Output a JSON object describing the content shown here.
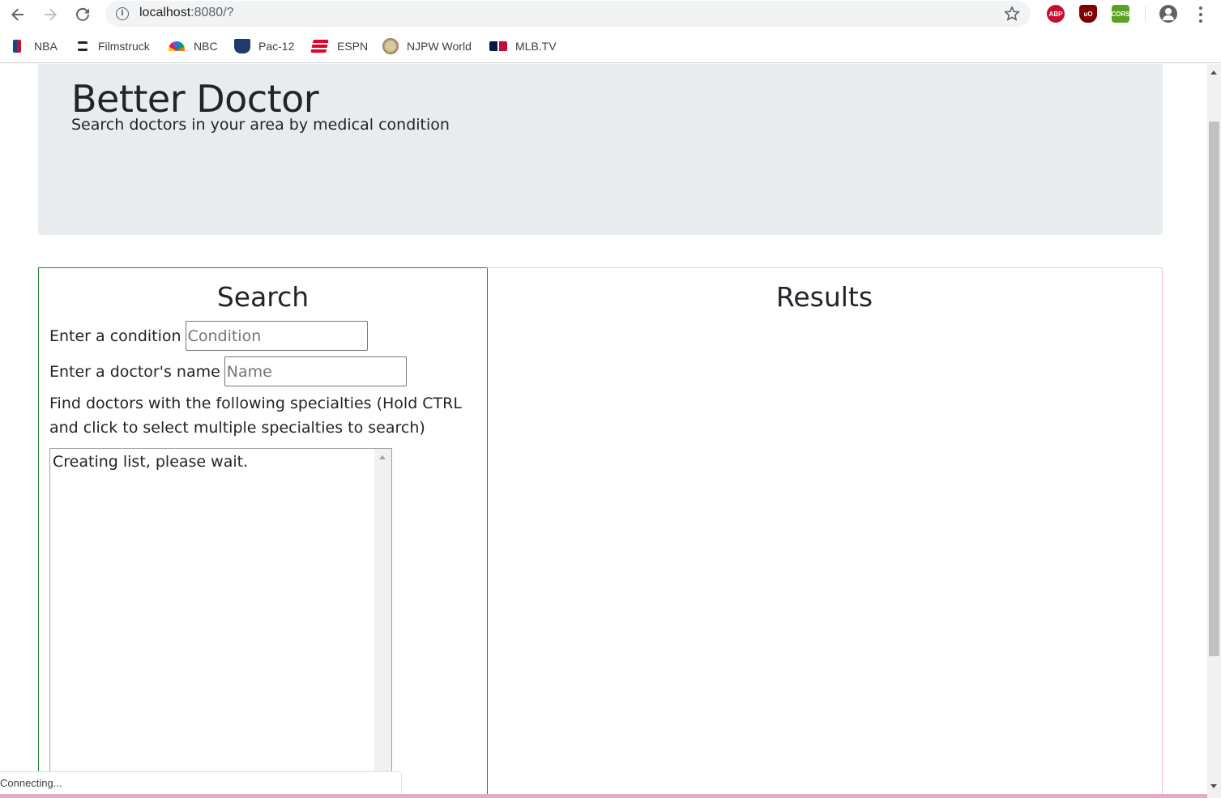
{
  "browser": {
    "url_host": "localhost",
    "url_path": ":8080/?",
    "bookmarks": [
      "NBA",
      "Filmstruck",
      "NBC",
      "Pac-12",
      "ESPN",
      "NJPW World",
      "MLB.TV"
    ],
    "extensions": {
      "abp": "ABP",
      "ubo": "uO",
      "cors": "CORS"
    },
    "status_text": "Connecting..."
  },
  "header": {
    "title": "Better Doctor",
    "subtitle": "Search doctors in your area by medical condition"
  },
  "search": {
    "title": "Search",
    "condition_label": "Enter a condition",
    "condition_placeholder": "Condition",
    "name_label": "Enter a doctor's name",
    "name_placeholder": "Name",
    "specialties_help": "Find doctors with the following specialties (Hold CTRL and click to select multiple specialties to search)",
    "specialties_option": "Creating list, please wait."
  },
  "results": {
    "title": "Results"
  },
  "colors": {
    "jumbotron_bg": "#e9ecef",
    "search_border": "#2e7d32",
    "results_border": "#f5c6d0"
  }
}
